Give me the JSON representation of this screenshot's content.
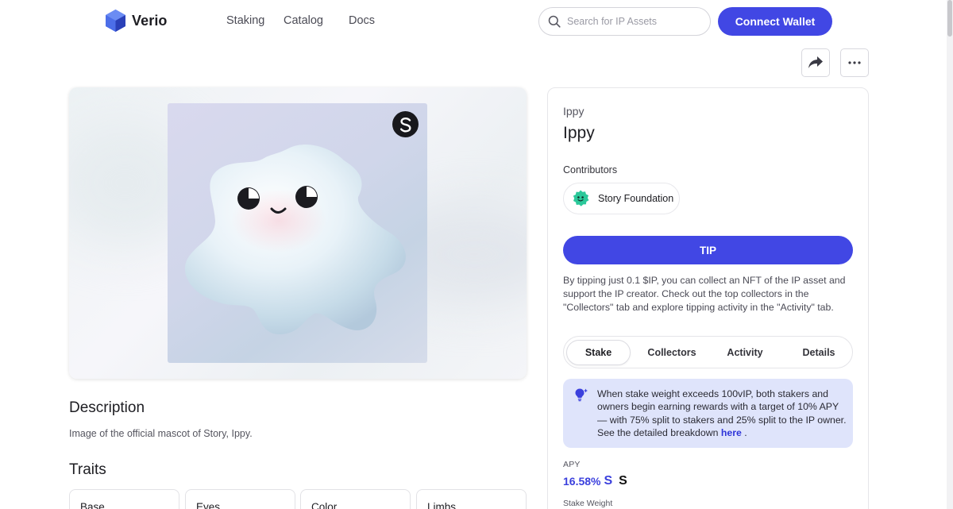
{
  "header": {
    "brand": "Verio",
    "nav": [
      "Staking",
      "Catalog",
      "Docs"
    ],
    "search_placeholder": "Search for IP Assets",
    "connect_label": "Connect Wallet"
  },
  "actions": {
    "share_icon": "share-icon",
    "more_icon": "more-horizontal-icon"
  },
  "asset": {
    "collection": "Ippy",
    "name": "Ippy",
    "description_title": "Description",
    "description": "Image of the official mascot of Story, Ippy.",
    "traits_title": "Traits",
    "traits": [
      "Base",
      "Eyes",
      "Color",
      "Limbs"
    ]
  },
  "contributors": {
    "label": "Contributors",
    "items": [
      {
        "name": "Story Foundation"
      }
    ]
  },
  "tip": {
    "button": "TIP",
    "note": "By tipping just 0.1 $IP, you can collect an NFT of the IP asset and support the IP creator. Check out the top collectors in the \"Collectors\" tab and explore tipping activity in the \"Activity\" tab."
  },
  "tabs": [
    "Stake",
    "Collectors",
    "Activity",
    "Details"
  ],
  "active_tab": "Stake",
  "stake": {
    "info_text": "When stake weight exceeds 100vIP, both stakers and owners begin earning rewards with a target of 10% APY — with 75% split to stakers and 25% split to the IP owner. See the detailed breakdown",
    "info_link": "here",
    "info_end": ".",
    "apy_label": "APY",
    "apy_value": "16.58%",
    "stake_weight_label": "Stake Weight"
  },
  "colors": {
    "accent": "#4147e4",
    "info_bg": "#dfe4fb"
  }
}
